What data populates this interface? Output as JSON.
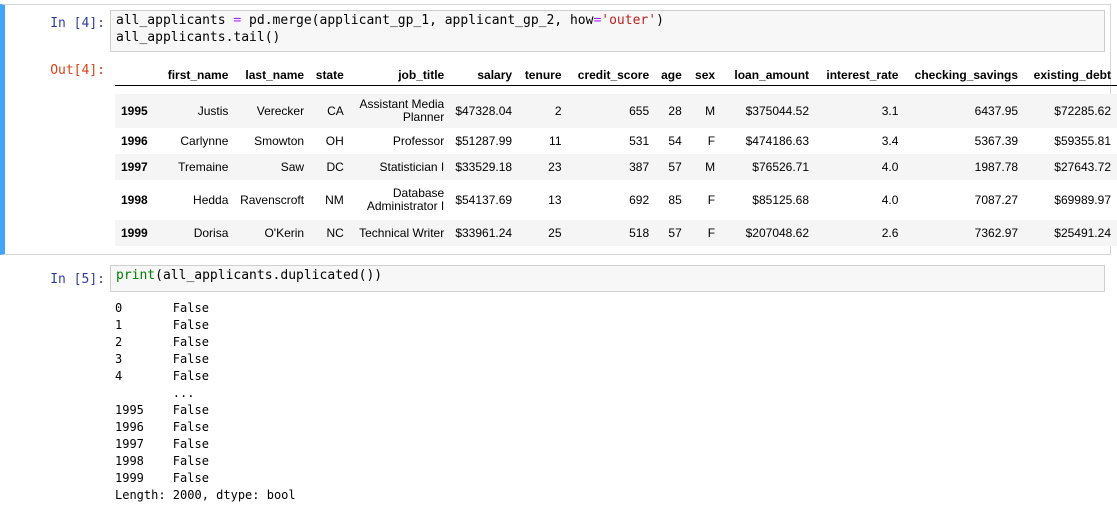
{
  "cell4": {
    "in_prompt": "In [4]:",
    "out_prompt": "Out[4]:",
    "code": {
      "line1_var": "all_applicants ",
      "line1_eq": "=",
      "line1_mid": " pd.merge(applicant_gp_1, applicant_gp_2, how",
      "line1_eq2": "=",
      "line1_str": "'outer'",
      "line1_end": ")",
      "line2": "all_applicants.tail()"
    },
    "table": {
      "columns": [
        "first_name",
        "last_name",
        "state",
        "job_title",
        "salary",
        "tenure",
        "credit_score",
        "age",
        "sex",
        "loan_amount",
        "interest_rate",
        "checking_savings",
        "existing_debt"
      ],
      "rows": [
        {
          "index": "1995",
          "cells": [
            "Justis",
            "Verecker",
            "CA",
            "Assistant Media Planner",
            "$47328.04",
            "2",
            "655",
            "28",
            "M",
            "$375044.52",
            "3.1",
            "6437.95",
            "$72285.62"
          ]
        },
        {
          "index": "1996",
          "cells": [
            "Carlynne",
            "Smowton",
            "OH",
            "Professor",
            "$51287.99",
            "11",
            "531",
            "54",
            "F",
            "$474186.63",
            "3.4",
            "5367.39",
            "$59355.81"
          ]
        },
        {
          "index": "1997",
          "cells": [
            "Tremaine",
            "Saw",
            "DC",
            "Statistician I",
            "$33529.18",
            "23",
            "387",
            "57",
            "M",
            "$76526.71",
            "4.0",
            "1987.78",
            "$27643.72"
          ]
        },
        {
          "index": "1998",
          "cells": [
            "Hedda",
            "Ravenscroft",
            "NM",
            "Database Administrator I",
            "$54137.69",
            "13",
            "692",
            "85",
            "F",
            "$85125.68",
            "4.0",
            "7087.27",
            "$69989.97"
          ]
        },
        {
          "index": "1999",
          "cells": [
            "Dorisa",
            "O'Kerin",
            "NC",
            "Technical Writer",
            "$33961.24",
            "25",
            "518",
            "57",
            "F",
            "$207048.62",
            "2.6",
            "7362.97",
            "$25491.24"
          ]
        }
      ]
    }
  },
  "cell5": {
    "in_prompt": "In [5]:",
    "code": {
      "builtin": "print",
      "rest": "(all_applicants.duplicated())"
    },
    "output_lines": [
      "0       False",
      "1       False",
      "2       False",
      "3       False",
      "4       False",
      "        ...",
      "1995    False",
      "1996    False",
      "1997    False",
      "1998    False",
      "1999    False",
      "Length: 2000, dtype: bool"
    ]
  }
}
